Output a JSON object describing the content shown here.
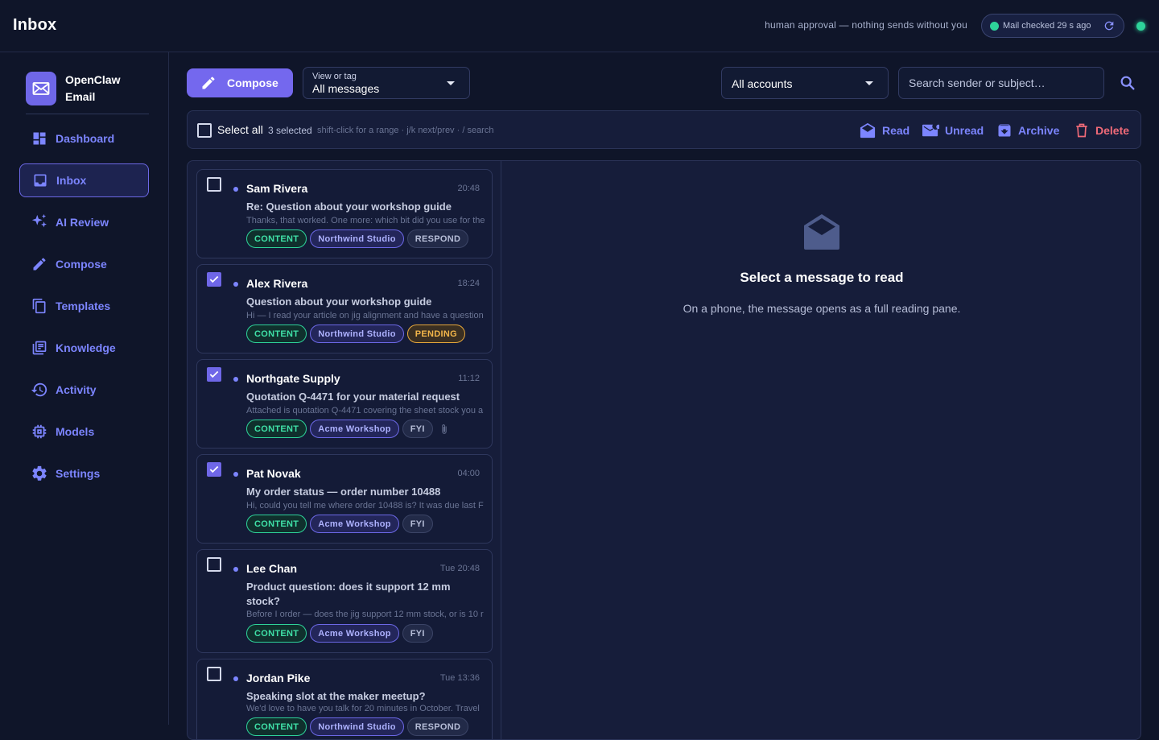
{
  "header": {
    "title": "Inbox",
    "approval_note": "human approval — nothing sends without you",
    "mail_status": "Mail checked 29 s ago"
  },
  "brand": {
    "name": "OpenClaw Email"
  },
  "sidebar": {
    "items": [
      {
        "label": "Dashboard",
        "icon": "dashboard-icon"
      },
      {
        "label": "Inbox",
        "icon": "inbox-icon",
        "active": true
      },
      {
        "label": "AI Review",
        "icon": "sparkle-icon"
      },
      {
        "label": "Compose",
        "icon": "pencil-icon"
      },
      {
        "label": "Templates",
        "icon": "copy-icon"
      },
      {
        "label": "Knowledge",
        "icon": "library-icon"
      },
      {
        "label": "Activity",
        "icon": "history-icon"
      },
      {
        "label": "Models",
        "icon": "chip-icon"
      },
      {
        "label": "Settings",
        "icon": "gear-icon"
      }
    ]
  },
  "toolbar": {
    "compose_label": "Compose",
    "view_label": "View or tag",
    "view_value": "All messages",
    "accounts_value": "All accounts",
    "search_placeholder": "Search sender or subject…"
  },
  "bulk": {
    "select_all_label": "Select all",
    "selected_count": "3 selected",
    "hint": "shift-click for a range · j/k next/prev · / search",
    "read_label": "Read",
    "unread_label": "Unread",
    "archive_label": "Archive",
    "delete_label": "Delete"
  },
  "messages": [
    {
      "sender": "Sam Rivera",
      "time": "20:48",
      "checked": false,
      "subject": "Re: Question about your workshop guide",
      "preview": "Thanks, that worked. One more: which bit did you use for the",
      "tags": [
        {
          "label": "CONTENT",
          "kind": "content"
        },
        {
          "label": "Northwind Studio",
          "kind": "org"
        },
        {
          "label": "RESPOND",
          "kind": "respond"
        }
      ]
    },
    {
      "sender": "Alex Rivera",
      "time": "18:24",
      "checked": true,
      "subject": "Question about your workshop guide",
      "preview": "Hi — I read your article on jig alignment and have a question",
      "tags": [
        {
          "label": "CONTENT",
          "kind": "content"
        },
        {
          "label": "Northwind Studio",
          "kind": "org"
        },
        {
          "label": "PENDING",
          "kind": "pending"
        }
      ]
    },
    {
      "sender": "Northgate Supply",
      "time": "11:12",
      "checked": true,
      "subject": "Quotation Q-4471 for your material request",
      "preview": "Attached is quotation Q-4471 covering the sheet stock you a",
      "attachment": true,
      "tags": [
        {
          "label": "CONTENT",
          "kind": "content"
        },
        {
          "label": "Acme Workshop",
          "kind": "org"
        },
        {
          "label": "FYI",
          "kind": "fyi"
        }
      ]
    },
    {
      "sender": "Pat Novak",
      "time": "04:00",
      "checked": true,
      "subject": "My order status — order number 10488",
      "preview": "Hi, could you tell me where order 10488 is? It was due last F",
      "tags": [
        {
          "label": "CONTENT",
          "kind": "content"
        },
        {
          "label": "Acme Workshop",
          "kind": "org"
        },
        {
          "label": "FYI",
          "kind": "fyi"
        }
      ]
    },
    {
      "sender": "Lee Chan",
      "time": "Tue 20:48",
      "checked": false,
      "subject": "Product question: does it support 12 mm stock?",
      "preview": "Before I order — does the jig support 12 mm stock, or is 10 r",
      "tags": [
        {
          "label": "CONTENT",
          "kind": "content"
        },
        {
          "label": "Acme Workshop",
          "kind": "org"
        },
        {
          "label": "FYI",
          "kind": "fyi"
        }
      ]
    },
    {
      "sender": "Jordan Pike",
      "time": "Tue 13:36",
      "checked": false,
      "subject": "Speaking slot at the maker meetup?",
      "preview": "We'd love to have you talk for 20 minutes in October. Travel",
      "tags": [
        {
          "label": "CONTENT",
          "kind": "content"
        },
        {
          "label": "Northwind Studio",
          "kind": "org"
        },
        {
          "label": "RESPOND",
          "kind": "respond"
        }
      ]
    }
  ],
  "reader": {
    "title": "Select a message to read",
    "subtitle": "On a phone, the message opens as a full reading pane."
  },
  "colors": {
    "accent": "#7468ee",
    "link": "#7c85ff",
    "success": "#2ed39a",
    "danger": "#f06a78",
    "warning": "#f3b64a"
  }
}
